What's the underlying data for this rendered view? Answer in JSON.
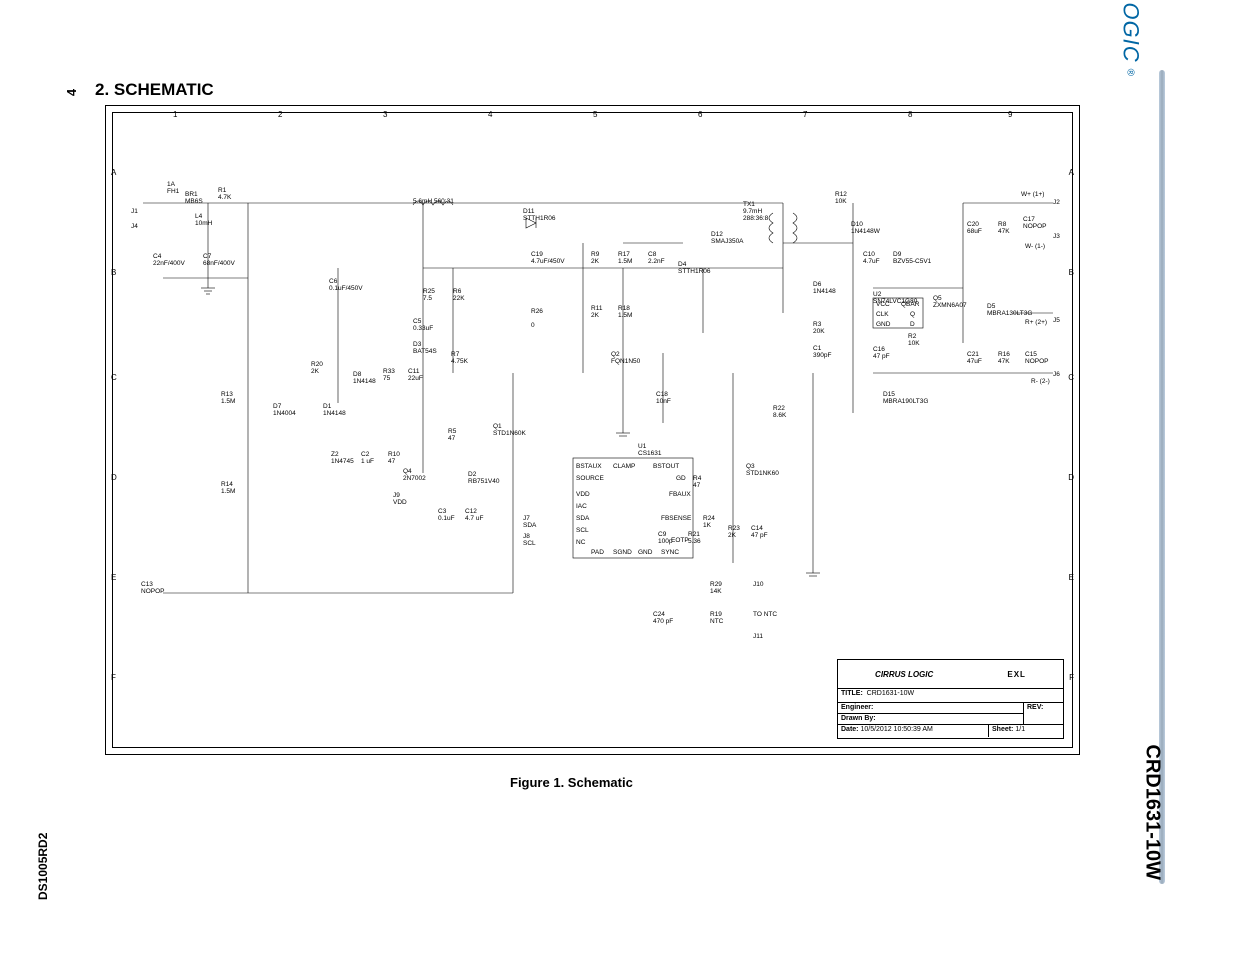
{
  "page_number_left": "4",
  "section_heading": "2.  SCHEMATIC",
  "figure_caption": "Figure 1.  Schematic",
  "footer_doc_code": "DS1005RD2",
  "brand_name": "CIRRUS LOGIC",
  "brand_reg": "®",
  "product_number": "CRD1631-10W",
  "frame": {
    "columns": [
      "1",
      "2",
      "3",
      "4",
      "5",
      "6",
      "7",
      "8",
      "9"
    ],
    "rows": [
      "A",
      "B",
      "C",
      "D",
      "E",
      "F"
    ]
  },
  "titleblock": {
    "logo1": "CIRRUS LOGIC",
    "logo2": "EXL",
    "title_label": "TITLE:",
    "title_value": "CRD1631-10W",
    "engineer_label": "Engineer:",
    "rev_label": "REV:",
    "drawn_label": "Drawn By:",
    "date_label": "Date:",
    "date_value": "10/5/2012 10:50:39 AM",
    "sheet_label": "Sheet:",
    "sheet_value": "1/1"
  },
  "connectors": {
    "J1": "J1",
    "J2": "J2",
    "J3": "J3",
    "J4": "J4",
    "J5": "J5",
    "J6": "J6",
    "J7": "SDA",
    "J8": "SCL",
    "J9": "VDD",
    "J10": "J10",
    "J11": "J11",
    "W_plus": "W+ (1+)",
    "W_minus": "W- (1-)",
    "R_plus": "R+ (2+)",
    "R_minus": "R- (2-)",
    "to_ntc": "TO NTC",
    "J7_lbl": "J7",
    "J8_lbl": "J8",
    "J9_lbl": "J9"
  },
  "components": {
    "FH1": {
      "ref": "FH1",
      "val": "1A"
    },
    "BR1": {
      "ref": "BR1",
      "val": "MB6S"
    },
    "R1": {
      "ref": "R1",
      "val": "4.7K"
    },
    "L4": {
      "ref": "L4",
      "val": "10mH"
    },
    "C4": {
      "ref": "C4",
      "val": "22nF/400V"
    },
    "C7": {
      "ref": "C7",
      "val": "68nF/400V"
    },
    "L1": {
      "ref": "",
      "val": "5.6mH\n560:31"
    },
    "D11": {
      "ref": "D11",
      "val": "STTH1R06"
    },
    "C6": {
      "ref": "C6",
      "val": "0.1uF/450V"
    },
    "R25": {
      "ref": "R25",
      "val": "7.5"
    },
    "R6": {
      "ref": "R6",
      "val": "22K"
    },
    "C5": {
      "ref": "C5",
      "val": "0.33uF"
    },
    "D3": {
      "ref": "D3",
      "val": "BAT54S"
    },
    "R7": {
      "ref": "R7",
      "val": "4.75K"
    },
    "R20": {
      "ref": "R20",
      "val": "2K"
    },
    "D8": {
      "ref": "D8",
      "val": "1N4148"
    },
    "R33": {
      "ref": "R33",
      "val": "75"
    },
    "C11": {
      "ref": "C11",
      "val": "22uF"
    },
    "R13": {
      "ref": "R13",
      "val": "1.5M"
    },
    "D7": {
      "ref": "D7",
      "val": "1N4004"
    },
    "D1": {
      "ref": "D1",
      "val": "1N4148"
    },
    "Z2": {
      "ref": "Z2",
      "val": "1N4745"
    },
    "C2": {
      "ref": "C2",
      "val": "1 uF"
    },
    "R10": {
      "ref": "R10",
      "val": "47"
    },
    "R14": {
      "ref": "R14",
      "val": "1.5M"
    },
    "C13": {
      "ref": "C13",
      "val": "NOPOP"
    },
    "R5": {
      "ref": "R5",
      "val": "47"
    },
    "Q1": {
      "ref": "Q1",
      "val": "STD1N60K"
    },
    "Q4": {
      "ref": "Q4",
      "val": "2N7002"
    },
    "D2": {
      "ref": "D2",
      "val": "RB751V40"
    },
    "C3": {
      "ref": "C3",
      "val": "0.1uF"
    },
    "C12": {
      "ref": "C12",
      "val": "4.7 uF"
    },
    "R26": {
      "ref": "R26",
      "val": "0"
    },
    "C19": {
      "ref": "C19",
      "val": "4.7uF/450V"
    },
    "R9": {
      "ref": "R9",
      "val": "2K"
    },
    "R17": {
      "ref": "R17",
      "val": "1.5M"
    },
    "C8": {
      "ref": "C8",
      "val": "2.2nF"
    },
    "R11": {
      "ref": "R11",
      "val": "2K"
    },
    "R18": {
      "ref": "R18",
      "val": "1.5M"
    },
    "Q2": {
      "ref": "Q2",
      "val": "FQN1N50"
    },
    "C18": {
      "ref": "C18",
      "val": "10nF"
    },
    "U1": {
      "ref": "U1",
      "val": "CS1631"
    },
    "Q3": {
      "ref": "Q3",
      "val": "STD1NK60"
    },
    "R4": {
      "ref": "R4",
      "val": "47"
    },
    "R24": {
      "ref": "R24",
      "val": "1K"
    },
    "C9": {
      "ref": "C9",
      "val": "100p"
    },
    "R21": {
      "ref": "R21",
      "val": "5.36"
    },
    "R23": {
      "ref": "R23",
      "val": "2K"
    },
    "C14": {
      "ref": "C14",
      "val": "47 pF"
    },
    "C24": {
      "ref": "C24",
      "val": "470 pF"
    },
    "R29": {
      "ref": "R29",
      "val": "14K"
    },
    "R19": {
      "ref": "R19",
      "val": "NTC"
    },
    "D4": {
      "ref": "D4",
      "val": "STTH1R06"
    },
    "D12": {
      "ref": "D12",
      "val": "SMAJ350A"
    },
    "TX1": {
      "ref": "TX1",
      "val": "9.7mH\n288:36:8"
    },
    "D6": {
      "ref": "D6",
      "val": "1N4148"
    },
    "R3": {
      "ref": "R3",
      "val": "20K"
    },
    "C1": {
      "ref": "C1",
      "val": "390pF"
    },
    "R22": {
      "ref": "R22",
      "val": "8.6K"
    },
    "U2": {
      "ref": "U2",
      "val": "SN74LVC1G80"
    },
    "R2": {
      "ref": "R2",
      "val": "10K"
    },
    "C16": {
      "ref": "C16",
      "val": "47 pF"
    },
    "Q5": {
      "ref": "Q5",
      "val": "ZXMN6A07"
    },
    "D15": {
      "ref": "D15",
      "val": "MBRA190LT3G"
    },
    "R12": {
      "ref": "R12",
      "val": "10K"
    },
    "D10": {
      "ref": "D10",
      "val": "1N4148W"
    },
    "C10": {
      "ref": "C10",
      "val": "4.7uF"
    },
    "D9": {
      "ref": "D9",
      "val": "BZV55-C5V1"
    },
    "C20": {
      "ref": "C20",
      "val": "68uF"
    },
    "R8": {
      "ref": "R8",
      "val": "47K"
    },
    "C17": {
      "ref": "C17",
      "val": "NOPOP"
    },
    "D5": {
      "ref": "D5",
      "val": "MBRA130LT3G"
    },
    "C21": {
      "ref": "C21",
      "val": "47uF"
    },
    "R16": {
      "ref": "R16",
      "val": "47K"
    },
    "C15": {
      "ref": "C15",
      "val": "NOPOP"
    }
  },
  "u1_pins": {
    "p2": "IAC",
    "p5": "BSTAUX",
    "p6": "SDA",
    "p7": "SCL",
    "p8": "NC",
    "p9": "PAD",
    "p10": "EOTP",
    "p11": "FBSENSE",
    "p13": "GD",
    "p14": "VDD",
    "p15": "FBAUX",
    "clamp": "CLAMP",
    "bstout": "BSTOUT",
    "source": "SOURCE",
    "sgnd": "SGND",
    "gnd": "GND",
    "sync": "SYNC"
  },
  "u2_pins": {
    "vcc": "VCC",
    "qbar": "QBAR",
    "clk": "CLK",
    "gnd": "GND",
    "d": "D",
    "q": "Q"
  }
}
